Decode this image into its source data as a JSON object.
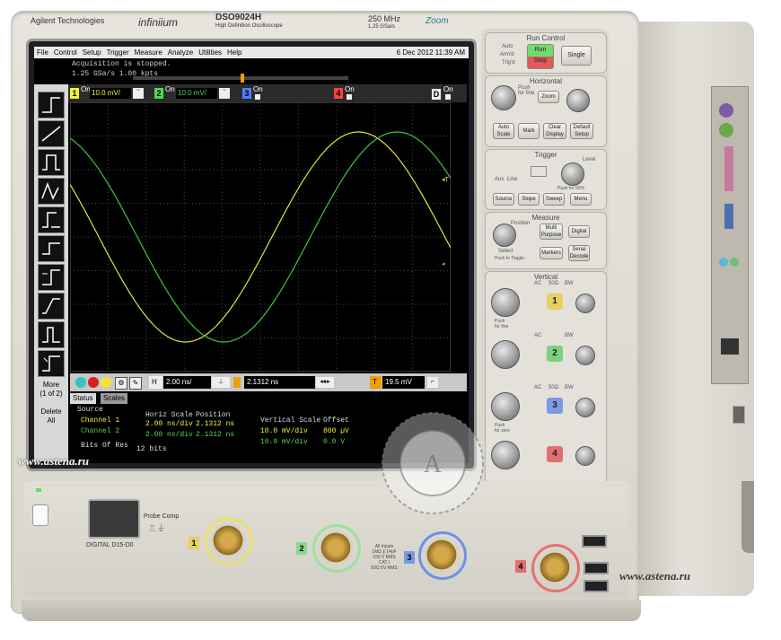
{
  "brand": {
    "maker": "Agilent Technologies",
    "series": "infiniium",
    "model": "DSO9024H",
    "model_sub": "High Definition Oscilloscope",
    "bandwidth": "250 MHz",
    "sample_rate": "1.25 GSa/s",
    "zoom_logo": "Zoom"
  },
  "menubar": {
    "items": [
      "File",
      "Control",
      "Setup",
      "Trigger",
      "Measure",
      "Analyze",
      "Utilities",
      "Help"
    ],
    "datetime": "6 Dec 2012 11:39 AM"
  },
  "acquisition": {
    "status": "Acquisition is stopped.",
    "rate": "1.25 GSa/s  1.00 kpts"
  },
  "channels": [
    {
      "num": "1",
      "on_label": "On",
      "scale": "10.0 mV/",
      "color": "#f2f23a"
    },
    {
      "num": "2",
      "on_label": "On",
      "scale": "10.0 mV/",
      "color": "#4fd94f"
    },
    {
      "num": "3",
      "on_label": "On",
      "color": "#4f7fff"
    },
    {
      "num": "4",
      "on_label": "On",
      "color": "#ff4040"
    },
    {
      "num": "D",
      "on_label": "On",
      "color": "#000000"
    }
  ],
  "left_toolbar": {
    "more_label": "More\n(1 of 2)",
    "delete_label": "Delete\nAll"
  },
  "lower_toolbar": {
    "h_label": "H",
    "timebase": "2.00 ns/",
    "delay": "2.1312 ns",
    "trigger_label": "T",
    "trigger_level": "19.5 mV"
  },
  "status_panel": {
    "tabs": [
      "Status",
      "Scales"
    ],
    "headers": {
      "source": "Source",
      "horiz_scale": "Horiz Scale",
      "position": "Position",
      "vert_scale": "Vertical Scale",
      "offset": "Offset"
    },
    "rows": [
      {
        "source": "Channel 1",
        "horiz": "2.00 ns/div",
        "position": "2.1312 ns",
        "vert": "10.0 mV/div",
        "offset": "800 µV"
      },
      {
        "source": "Channel 2",
        "horiz": "2.00 ns/div",
        "position": "2.1312 ns",
        "vert": "10.0 mV/div",
        "offset": "0.0 V"
      }
    ],
    "bits_label": "Bits Of Res",
    "bits_value": "12 bits"
  },
  "panel": {
    "run_control": "Run Control",
    "auto_label": "Auto",
    "armd_label": "Arm'd",
    "trigd_label": "Trig'd",
    "run_stop": "Run\nStop",
    "single": "Single",
    "horizontal": "Horizontal",
    "push_for_fine": "Push\nfor fine",
    "zoom": "Zoom",
    "auto_scale": "Auto\nScale",
    "mark": "Mark",
    "clear_display": "Clear\nDisplay",
    "default_setup": "Default\nSetup",
    "trigger": "Trigger",
    "aux": "Aux",
    "line": "Line",
    "level": "Level",
    "push_50": "Push for 50%",
    "source": "Source",
    "slope": "Slope",
    "sweep": "Sweep",
    "menu": "Menu",
    "measure": "Measure",
    "position": "Position",
    "select": "Select",
    "push_to_toggle": "Push to Toggle",
    "multi_purpose": "Multi\nPurpose",
    "digital": "Digital",
    "markers": "Markers",
    "serial_decode": "Serial\nDecode",
    "vertical": "Vertical",
    "push_for_zero": "Push\nfor zero",
    "push_for_fine_v": "Push\nfor fine",
    "ac": "AC",
    "ohm50": "50Ω",
    "bw": "BW",
    "vch": [
      "1",
      "2",
      "3",
      "4"
    ]
  },
  "front": {
    "probe_comp": "Probe Comp",
    "digital_label": "DIGITAL D15-D0",
    "input_note": "All Inputs\n1MΩ ∥ 14pF\n150 V RMS\nCAT I\n50Ω  5V RMS",
    "bnc_nums": [
      "1",
      "2",
      "3",
      "4"
    ]
  },
  "watermarks": [
    "www.astena.ru",
    "www.astena.ru"
  ],
  "chart_data": {
    "type": "line",
    "series": [
      {
        "values_phase_deg": 0,
        "color": "#e6e23c"
      },
      {
        "values_phase_deg": -40,
        "color": "#3fc43f"
      }
    ],
    "grid": true
  }
}
